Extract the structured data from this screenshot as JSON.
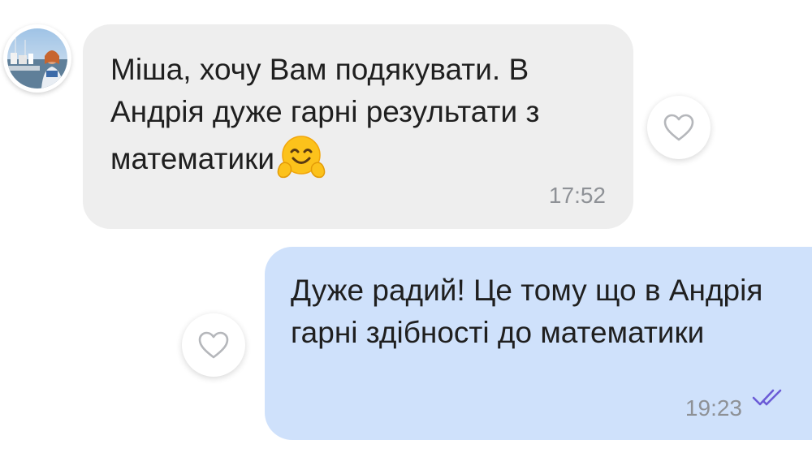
{
  "conversation": {
    "messages": [
      {
        "direction": "incoming",
        "text": "Міша, хочу Вам подякувати. В Андрія дуже гарні результати з математики",
        "emoji": "hugging-face-emoji",
        "time": "17:52",
        "like_icon": "heart-outline-icon"
      },
      {
        "direction": "outgoing",
        "text": "Дуже радий! Це тому що в Андрія гарні здібності до математики",
        "time": "19:23",
        "status_icon": "double-check-icon",
        "like_icon": "heart-outline-icon"
      }
    ]
  },
  "colors": {
    "incoming_bubble": "#eeeeee",
    "outgoing_bubble": "#cfe1fb",
    "timestamp": "#8e9196",
    "read_check": "#6b5bd6"
  }
}
